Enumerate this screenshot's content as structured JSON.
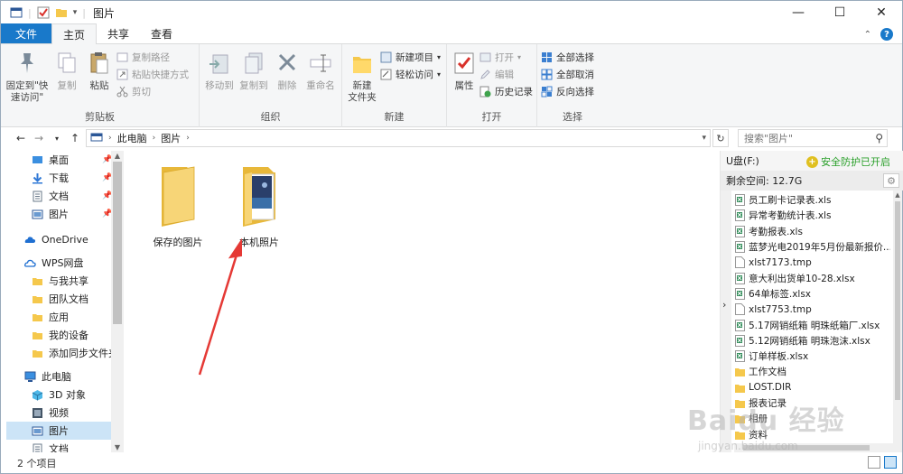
{
  "window": {
    "title": "图片",
    "minimize": "—",
    "maximize": "☐",
    "close": "✕"
  },
  "tabs": [
    {
      "label": "文件"
    },
    {
      "label": "主页"
    },
    {
      "label": "共享"
    },
    {
      "label": "查看"
    }
  ],
  "ribbon": {
    "clipboard": {
      "label": "剪贴板",
      "pin": "固定到\"快速访问\"",
      "copy": "复制",
      "paste": "粘贴",
      "copy_path": "复制路径",
      "paste_shortcut": "粘贴快捷方式",
      "cut": "剪切"
    },
    "organize": {
      "label": "组织",
      "move_to": "移动到",
      "copy_to": "复制到",
      "delete": "删除",
      "rename": "重命名"
    },
    "new": {
      "label": "新建",
      "new_folder": "新建\n文件夹",
      "new_item": "新建项目",
      "easy_access": "轻松访问"
    },
    "open": {
      "label": "打开",
      "properties": "属性",
      "open": "打开",
      "edit": "编辑",
      "history": "历史记录"
    },
    "select": {
      "label": "选择",
      "select_all": "全部选择",
      "select_none": "全部取消",
      "invert": "反向选择"
    }
  },
  "address": {
    "path": [
      "此电脑",
      "图片"
    ],
    "search_placeholder": "搜索\"图片\""
  },
  "nav": {
    "quick": [
      {
        "label": "桌面"
      },
      {
        "label": "下载"
      },
      {
        "label": "文档"
      },
      {
        "label": "图片"
      }
    ],
    "onedrive": "OneDrive",
    "wps": "WPS网盘",
    "wps_items": [
      {
        "label": "与我共享"
      },
      {
        "label": "团队文档"
      },
      {
        "label": "应用"
      },
      {
        "label": "我的设备"
      },
      {
        "label": "添加同步文件夹"
      }
    ],
    "pc": "此电脑",
    "pc_items": [
      {
        "label": "3D 对象"
      },
      {
        "label": "视频"
      },
      {
        "label": "图片"
      },
      {
        "label": "文档"
      }
    ]
  },
  "content": {
    "folders": [
      {
        "label": "保存的图片"
      },
      {
        "label": "本机照片"
      }
    ]
  },
  "preview": {
    "drive": "U盘(F:)",
    "safe": "安全防护已开启",
    "free": "剩余空间: 12.7G",
    "items": [
      {
        "label": "员工刷卡记录表.xls",
        "type": "xls"
      },
      {
        "label": "异常考勤统计表.xls",
        "type": "xls"
      },
      {
        "label": "考勤报表.xls",
        "type": "xls"
      },
      {
        "label": "蓝梦光电2019年5月份最新报价...",
        "type": "xls"
      },
      {
        "label": "xlst7173.tmp",
        "type": "file"
      },
      {
        "label": "意大利出货单10-28.xlsx",
        "type": "xls"
      },
      {
        "label": "64单标签.xlsx",
        "type": "xls"
      },
      {
        "label": "xlst7753.tmp",
        "type": "file"
      },
      {
        "label": "5.17网销纸箱 明珠纸箱厂.xlsx",
        "type": "xls"
      },
      {
        "label": "5.12网销纸箱 明珠泡沫.xlsx",
        "type": "xls"
      },
      {
        "label": "订单样板.xlsx",
        "type": "xls"
      },
      {
        "label": "工作文档",
        "type": "folder"
      },
      {
        "label": "LOST.DIR",
        "type": "folder"
      },
      {
        "label": "报表记录",
        "type": "folder"
      },
      {
        "label": "相册",
        "type": "folder"
      },
      {
        "label": "资料",
        "type": "folder"
      }
    ]
  },
  "status": {
    "count": "2 个项目"
  },
  "watermark": {
    "logo": "Baidu 经验",
    "url": "jingyan.baidu.com"
  }
}
